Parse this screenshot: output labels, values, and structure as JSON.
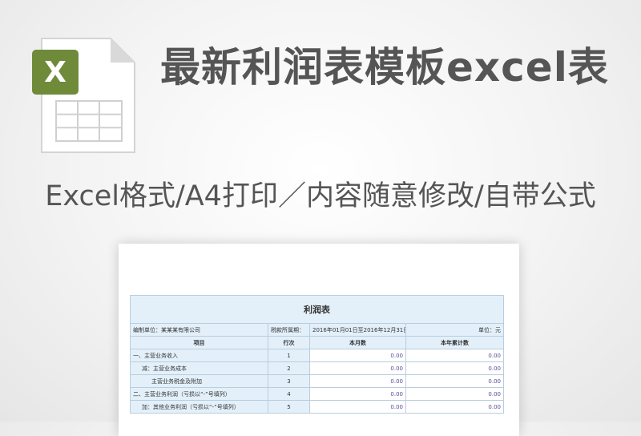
{
  "header": {
    "title": "最新利润表模板excel表",
    "subtitle": "Excel格式/A4打印／内容随意修改/自带公式",
    "icon_letter": "X"
  },
  "sheet": {
    "title": "利润表",
    "unit_label": "编制单位：某某某有限公司",
    "period_label": "税款所属期：",
    "period_value": "2016年01月01日至2016年12月31日",
    "currency_label": "单位：元",
    "columns": [
      "项目",
      "行次",
      "本月数",
      "本年累计数"
    ],
    "rows": [
      {
        "item": "一、主营业务收入",
        "line": "1",
        "month": "0.00",
        "year": "0.00"
      },
      {
        "item": "减：主营业务成本",
        "line": "2",
        "month": "0.00",
        "year": "0.00"
      },
      {
        "item": "主营业务税金及附加",
        "line": "3",
        "month": "0.00",
        "year": "0.00"
      },
      {
        "item": "二、主营业务利润（亏损以“-”号填列）",
        "line": "4",
        "month": "0.00",
        "year": "0.00"
      },
      {
        "item": "加：其他业务利润（亏损以“-”号填列）",
        "line": "5",
        "month": "0.00",
        "year": "0.00"
      }
    ]
  },
  "colors": {
    "icon_green": "#6f8b3a",
    "header_blue": "#e3f0fa",
    "value_purple": "#5a4a9a"
  }
}
